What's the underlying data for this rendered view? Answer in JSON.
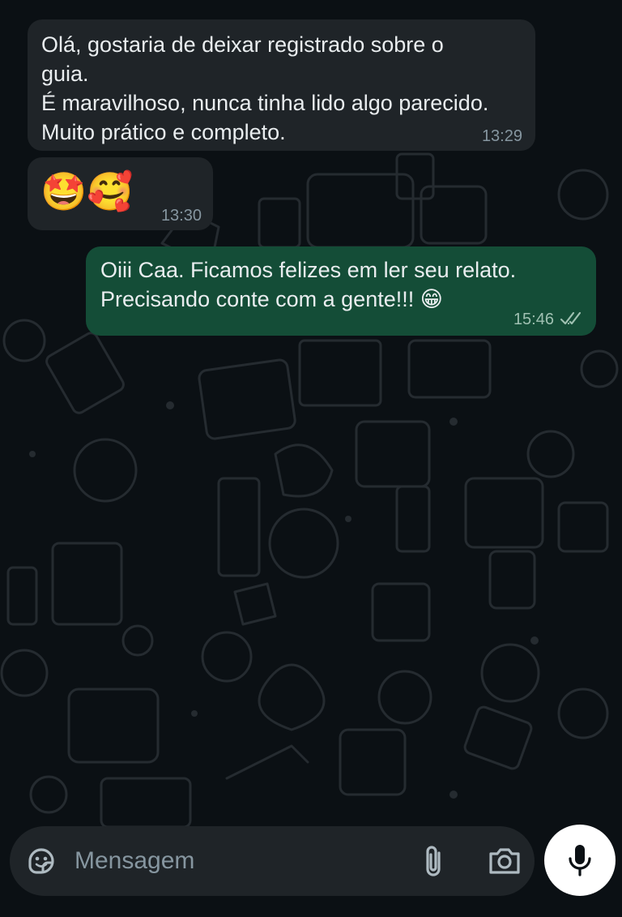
{
  "messages": [
    {
      "direction": "incoming",
      "text": "Olá, gostaria de deixar registrado sobre o guia.\nÉ maravilhoso, nunca tinha lido algo parecido. Muito prático e completo.",
      "time": "13:29"
    },
    {
      "direction": "incoming",
      "emoji": "🤩🥰",
      "time": "13:30"
    },
    {
      "direction": "outgoing",
      "text": "Oiii Caa. Ficamos felizes em ler seu relato.\nPrecisando conte com a gente!!! 😁",
      "time": "15:46",
      "status": "read"
    }
  ],
  "composer": {
    "placeholder": "Mensagem",
    "value": ""
  },
  "icons": {
    "sticker": "sticker-icon",
    "attach": "paperclip-icon",
    "camera": "camera-icon",
    "mic": "microphone-icon",
    "read_receipt": "double-check-icon"
  },
  "colors": {
    "background": "#0b1014",
    "incoming_bubble": "#1f2428",
    "outgoing_bubble": "#144d37",
    "text": "#e9edef",
    "timestamp": "#8696a0",
    "composer": "#1f2428",
    "mic_button": "#ffffff"
  }
}
